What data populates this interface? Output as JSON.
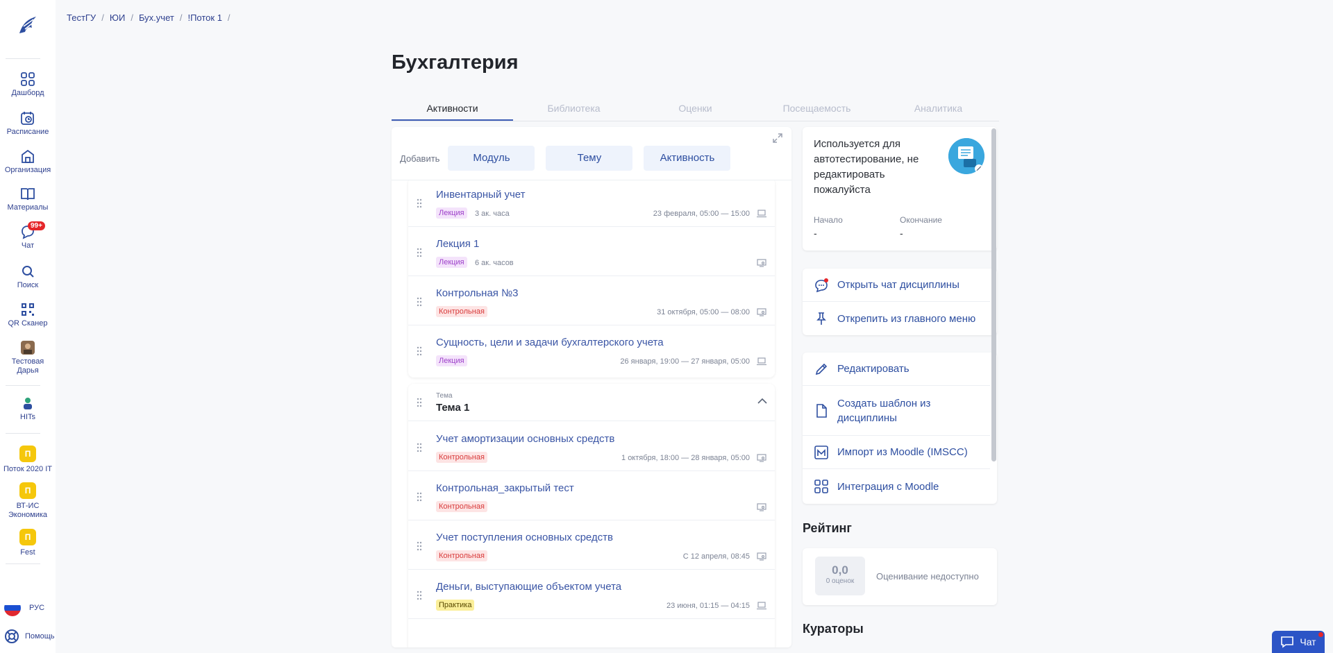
{
  "breadcrumb": [
    "ТестГУ",
    "ЮИ",
    "Бух.учет",
    "!Поток 1"
  ],
  "page_title": "Бухгалтерия",
  "tabs": [
    {
      "label": "Активности",
      "active": true
    },
    {
      "label": "Библиотека",
      "active": false
    },
    {
      "label": "Оценки",
      "active": false
    },
    {
      "label": "Посещаемость",
      "active": false
    },
    {
      "label": "Аналитика",
      "active": false
    }
  ],
  "sidebar": {
    "items": [
      {
        "label": "Дашборд",
        "icon": "grid-icon"
      },
      {
        "label": "Расписание",
        "icon": "calendar-clock-icon"
      },
      {
        "label": "Организация",
        "icon": "building-icon"
      },
      {
        "label": "Материалы",
        "icon": "book-icon"
      },
      {
        "label": "Чат",
        "icon": "chat-bubble-icon",
        "badge": "99+"
      },
      {
        "label": "Поиск",
        "icon": "search-icon"
      },
      {
        "label": "QR Сканер",
        "icon": "qr-code-icon"
      },
      {
        "label": "Тестовая Дарья",
        "icon": "user-avatar-icon"
      }
    ],
    "apps": [
      {
        "label": "HITs",
        "icon": "hits-logo-icon"
      }
    ],
    "courses": [
      {
        "letter": "П",
        "label": "Поток 2020 IT"
      },
      {
        "letter": "П",
        "label": "ВТ-ИС Экономика"
      },
      {
        "letter": "П",
        "label": "Fest"
      }
    ],
    "language": "РУС",
    "help": "Помощь"
  },
  "add_bar": {
    "label": "Добавить",
    "buttons": [
      "Модуль",
      "Тему",
      "Активность"
    ]
  },
  "group1_rows": [
    {
      "title": "Инвентарный учет",
      "tag": "Лекция",
      "tag_type": "lec",
      "duration": "3 ак. часа",
      "date": "23 февраля, 05:00 — 15:00",
      "icon": "laptop-icon"
    },
    {
      "title": "Лекция 1",
      "tag": "Лекция",
      "tag_type": "lec",
      "duration": "6 ак. часов",
      "date": "",
      "icon": "screen-user-icon"
    },
    {
      "title": "Контрольная №3",
      "tag": "Контрольная",
      "tag_type": "ctl",
      "duration": "",
      "date": "31 октября, 05:00 — 08:00",
      "icon": "screen-user-icon"
    },
    {
      "title": "Сущность, цели и задачи бухгалтерского учета",
      "tag": "Лекция",
      "tag_type": "lec",
      "duration": "",
      "date": "26 января, 19:00 — 27 января, 05:00",
      "icon": "laptop-icon"
    }
  ],
  "theme": {
    "kicker": "Тема",
    "title": "Тема 1",
    "rows": [
      {
        "title": "Учет амортизации основных средств",
        "tag": "Контрольная",
        "tag_type": "ctl",
        "duration": "",
        "date": "1 октября, 18:00 — 28 января, 05:00",
        "icon": "screen-user-icon"
      },
      {
        "title": "Контрольная_закрытый тест",
        "tag": "Контрольная",
        "tag_type": "ctl",
        "duration": "",
        "date": "",
        "icon": "screen-user-icon"
      },
      {
        "title": "Учет поступления основных средств",
        "tag": "Контрольная",
        "tag_type": "ctl",
        "duration": "",
        "date": "С 12 апреля, 08:45",
        "icon": "screen-user-icon"
      },
      {
        "title": "Деньги, выступающие объектом учета",
        "tag": "Практика",
        "tag_type": "prc",
        "duration": "",
        "date": "23 июня, 01:15 — 04:15",
        "icon": "laptop-icon"
      }
    ]
  },
  "info": {
    "description": "Используется для автотестирование, не редактировать пожалуйста",
    "start_label": "Начало",
    "start_value": "-",
    "end_label": "Окончание",
    "end_value": "-"
  },
  "chat_actions": [
    {
      "label": "Открыть чат дисциплины",
      "icon": "chat-dot-icon"
    },
    {
      "label": "Открепить из главного меню",
      "icon": "pin-icon"
    }
  ],
  "edit_actions": [
    {
      "label": "Редактировать",
      "icon": "pencil-icon"
    },
    {
      "label": "Создать шаблон из дисциплины",
      "icon": "document-icon"
    },
    {
      "label": "Импорт из Moodle (IMSCC)",
      "icon": "moodle-m-icon"
    },
    {
      "label": "Интеграция с Moodle",
      "icon": "grid-icon"
    }
  ],
  "rating": {
    "title": "Рейтинг",
    "score": "0,0",
    "score_sub": "0 оценок",
    "note": "Оценивание недоступно"
  },
  "curators_title": "Кураторы",
  "chat_button": "Чат",
  "colors": {
    "accent": "#2d4ea0",
    "active_tab_border": "#3d5cb4",
    "badge": "#e5262a",
    "course_yellow": "#f5c70c"
  }
}
